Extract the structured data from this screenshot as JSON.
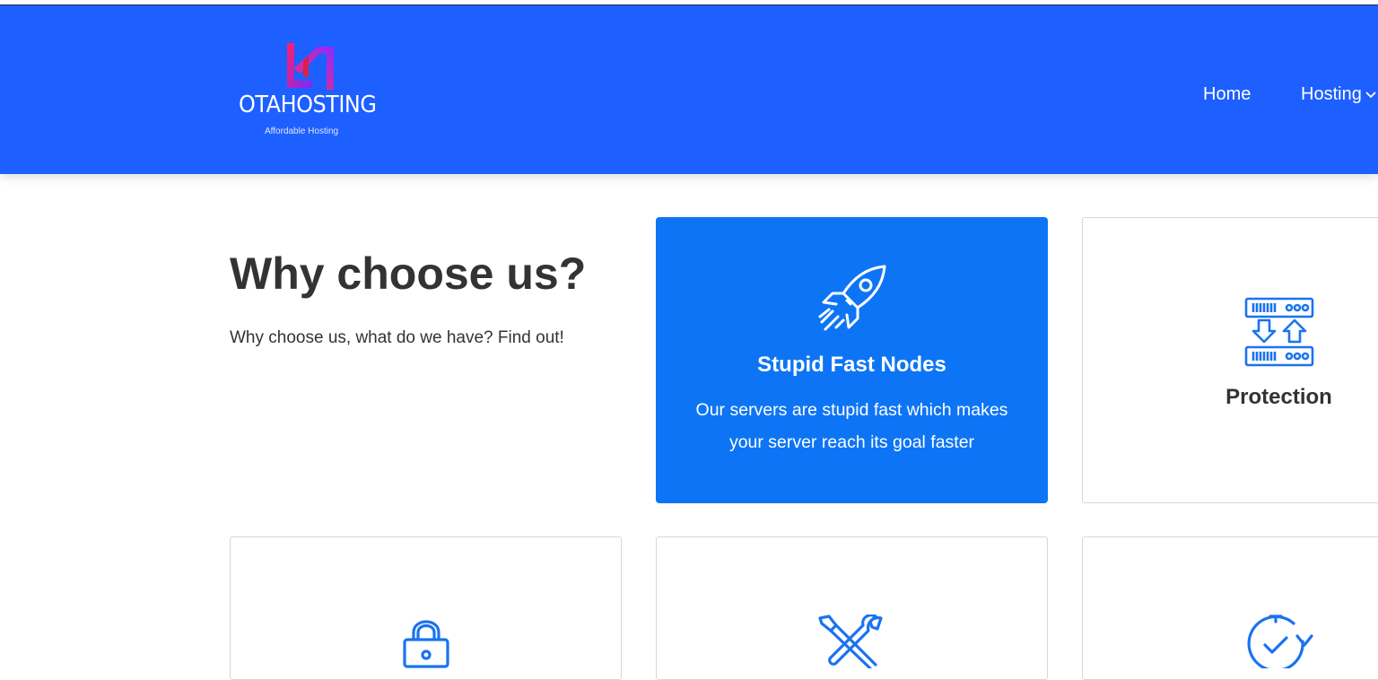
{
  "brand": {
    "name": "OTAHOSTING",
    "tagline": "Affordable Hosting",
    "colors": {
      "header": "#1e5fff",
      "card_active": "#0d75f5",
      "icon": "#1a73f0"
    }
  },
  "nav": {
    "items": [
      {
        "label": "Home"
      },
      {
        "label": "Hosting",
        "icon": "chevron-down-icon"
      }
    ]
  },
  "section": {
    "title": "Why choose us?",
    "subtitle": "Why choose us, what do we have? Find out!"
  },
  "features": [
    {
      "icon": "rocket-icon",
      "title": "Stupid Fast Nodes",
      "description": "Our servers are stupid fast which makes your server reach its goal faster",
      "active": true
    },
    {
      "icon": "server-transfer-icon",
      "title": "Protection"
    },
    {
      "icon": "padlock-icon"
    },
    {
      "icon": "tools-icon"
    },
    {
      "icon": "clock-refresh-icon"
    }
  ]
}
